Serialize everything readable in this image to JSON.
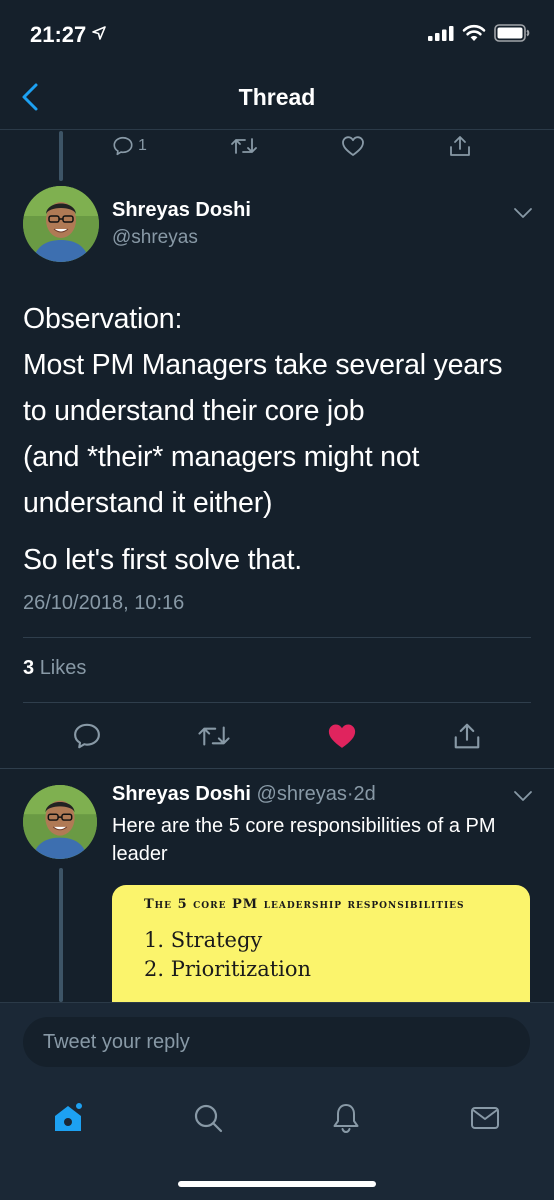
{
  "status_bar": {
    "time": "21:27",
    "icons": [
      "location-arrow-icon",
      "cellular-signal-icon",
      "wifi-icon",
      "battery-icon"
    ]
  },
  "header": {
    "title": "Thread",
    "back_icon": "chevron-left-icon"
  },
  "previous_tweet": {
    "reply_count": "1"
  },
  "main_tweet": {
    "author_name": "Shreyas Doshi",
    "author_handle": "@shreyas",
    "body_lines": [
      "Observation:",
      "Most PM Managers take several years",
      "to understand their core job",
      "(and *their* managers might not",
      "understand it either)"
    ],
    "body_second_paragraph": "So let's first solve that.",
    "timestamp": "26/10/2018, 10:16",
    "likes_count": "3",
    "likes_label": "Likes",
    "liked": true
  },
  "reply_tweet": {
    "author_name": "Shreyas Doshi",
    "author_handle": "@shreyas",
    "separator": "·",
    "time_ago": "2d",
    "text": "Here are the 5 core responsibilities of a PM leader",
    "media": {
      "title": "The 5 core PM leadership responsibilities",
      "items": [
        "1. Strategy",
        "2. Prioritization"
      ]
    }
  },
  "composer": {
    "placeholder": "Tweet your reply"
  },
  "tab_bar": {
    "tabs": [
      "home-icon",
      "search-icon",
      "notifications-icon",
      "messages-icon"
    ],
    "active": "home-icon"
  },
  "colors": {
    "background": "#15202b",
    "accent": "#1da1f2",
    "like": "#e0245e",
    "secondary_text": "#8899a6",
    "media_background": "#fbf46c"
  }
}
